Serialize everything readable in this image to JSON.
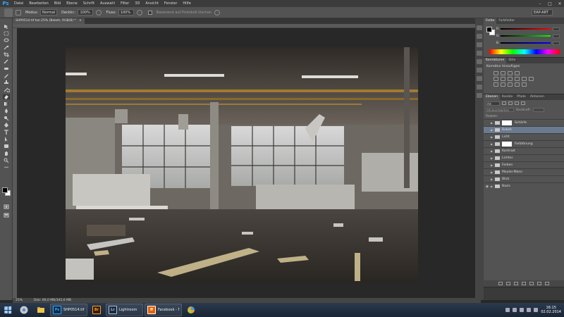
{
  "app": {
    "logo": "Ps",
    "menu": [
      "Datei",
      "Bearbeiten",
      "Bild",
      "Ebene",
      "Schrift",
      "Auswahl",
      "Filter",
      "3D",
      "Ansicht",
      "Fenster",
      "Hilfe"
    ],
    "window_controls": [
      "–",
      "□",
      "✕"
    ]
  },
  "options_bar": {
    "mode_label": "Modus:",
    "mode_value": "Normal",
    "opacity_label": "Deckkr.:",
    "opacity_value": "100%",
    "flow_label": "Fluss:",
    "flow_value": "100%",
    "erase_history_label": "Basierend auf Protokoll löschen",
    "workspace": "EAP-ART"
  },
  "document": {
    "tab_title": "SHP0514.tif bei 25% (Bokeh, RGB/8) *",
    "tab_close": "×",
    "zoom": "25%",
    "doc_info": "Dok: 66,0 MB/345,6 MB"
  },
  "color_panel": {
    "tabs": [
      "Farbe",
      "Farbfelder"
    ],
    "channels": [
      "R",
      "G",
      "B"
    ]
  },
  "adjustments_panel": {
    "tabs": [
      "Korrekturen",
      "Stile"
    ],
    "title": "Korrektur hinzufügen"
  },
  "layers_panel": {
    "tabs": [
      "Ebenen",
      "Kanäle",
      "Pfade",
      "Aktionen"
    ],
    "filter_label": "Art",
    "blend_mode": "Hindurchwirken",
    "opacity_label": "Deckkraft:",
    "lock_label": "Fixieren:",
    "layers": [
      {
        "name": "Schärfe",
        "visible": false,
        "type": "folder-mask",
        "selected": false
      },
      {
        "name": "Bokeh",
        "visible": false,
        "type": "folder",
        "selected": true
      },
      {
        "name": "Licht",
        "visible": false,
        "type": "folder",
        "selected": false
      },
      {
        "name": "Farbtönung",
        "visible": false,
        "type": "folder-mask",
        "selected": false
      },
      {
        "name": "Kontrast",
        "visible": false,
        "type": "folder",
        "selected": false
      },
      {
        "name": "Lichter",
        "visible": false,
        "type": "folder",
        "selected": false
      },
      {
        "name": "Farben",
        "visible": false,
        "type": "folder",
        "selected": false
      },
      {
        "name": "Mauler-Mann",
        "visible": false,
        "type": "folder",
        "selected": false
      },
      {
        "name": "Blick",
        "visible": false,
        "type": "folder",
        "selected": false
      },
      {
        "name": "Basis",
        "visible": true,
        "type": "folder",
        "selected": false
      }
    ]
  },
  "taskbar": {
    "apps": [
      {
        "label": "SHP0514.tif bei 2...",
        "icon_text": "Ps",
        "icon_color": "#0a2a4a",
        "text_color": "#31a8ff"
      },
      {
        "label": "",
        "icon_text": "Br",
        "icon_color": "#3a1a00",
        "text_color": "#f2a33a"
      },
      {
        "label": "Lightroom",
        "icon_text": "Lr",
        "icon_color": "#1c2a3a",
        "text_color": "#a9c4e2"
      },
      {
        "label": "Facebook - Mozil...",
        "icon_text": "ff",
        "icon_color": "#e66000",
        "text_color": "#ffffff"
      }
    ],
    "time": "16:15",
    "date": "02.02.2014"
  },
  "colors": {
    "ps_blue": "#31a8ff",
    "panel_bg": "#535353",
    "selected_layer": "#6b7b8f"
  }
}
